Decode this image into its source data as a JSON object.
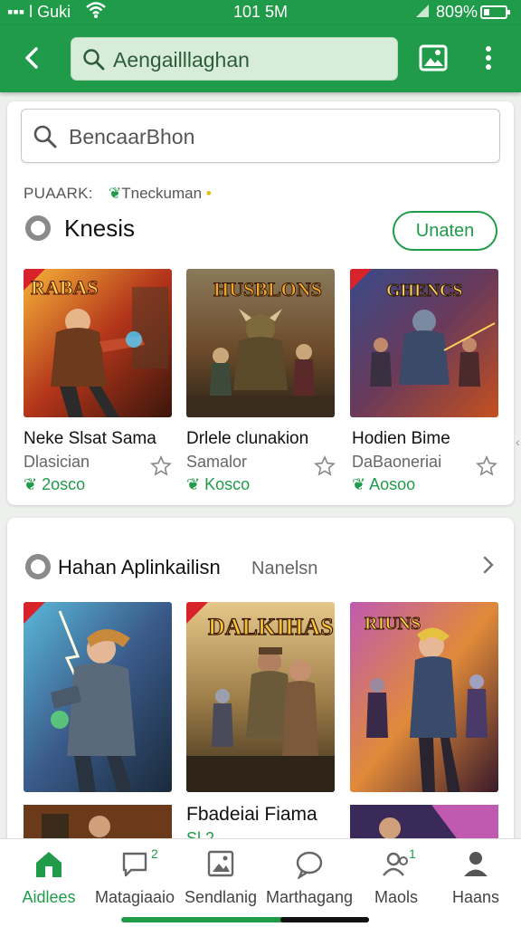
{
  "status_bar": {
    "carrier": "▪▪▪ l Guki",
    "time": "101 5M",
    "battery": "809%"
  },
  "app_bar": {
    "search_placeholder": "Aengailllaghan"
  },
  "content_search": {
    "placeholder": "BencaarBhon"
  },
  "breadcrumb": {
    "label": "PUAARK:",
    "link": "Tneckuman"
  },
  "section1": {
    "title": "Knesis",
    "button": "Unaten",
    "items": [
      {
        "title": "Neke Slsat Sama",
        "subtitle": "Dlasician",
        "price": "2osco",
        "art_text": "RABAS",
        "art": "fire"
      },
      {
        "title": "Drlele clunakion",
        "subtitle": "Samalor",
        "price": "Kosco",
        "art_text": "HUSBLONS",
        "art": "earth"
      },
      {
        "title": "Hodien Bime",
        "subtitle": "DaBaoneriai",
        "price": "Aosoo",
        "art_text": "GHENCS",
        "art": "storm"
      }
    ]
  },
  "section2": {
    "title": "Hahan Aplinkailisn",
    "subtitle": "Nanelsn",
    "items": [
      {
        "art_text": "",
        "art": "lightning"
      },
      {
        "art_text": "DALKIHAS",
        "art": "desert"
      },
      {
        "art_text": "RIUNS",
        "art": "neon"
      }
    ],
    "caption_title": "Fbadeiai Fiama",
    "caption_sub": "Sl 2"
  },
  "bottom_nav": [
    {
      "label": "Aidlees",
      "icon": "home-icon",
      "active": true
    },
    {
      "label": "Matagiaaio",
      "icon": "chat-icon",
      "badge": "2"
    },
    {
      "label": "Sendlanig",
      "icon": "image-icon"
    },
    {
      "label": "Marthagang",
      "icon": "speech-icon"
    },
    {
      "label": "Maols",
      "icon": "people-icon",
      "badge": "1"
    },
    {
      "label": "Haans",
      "icon": "person-icon"
    }
  ],
  "colors": {
    "primary": "#1f9b4a",
    "primary_light": "#d7ecd9",
    "text": "#202124"
  }
}
